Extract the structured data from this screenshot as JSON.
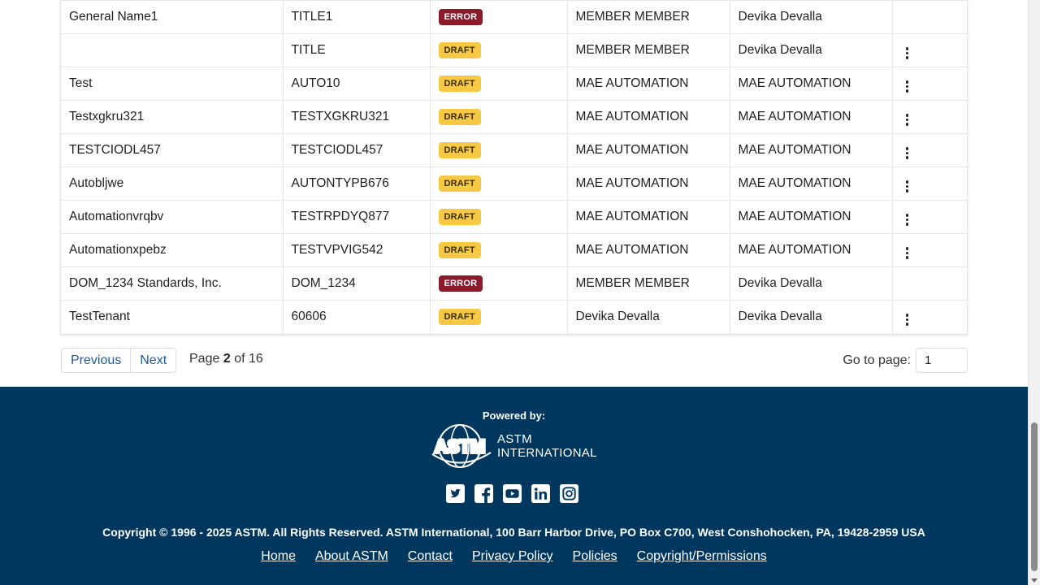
{
  "table": {
    "rows": [
      {
        "name": "General Name1",
        "code": "TITLE1",
        "status": "ERROR",
        "status_kind": "error",
        "created_by": "MEMBER MEMBER",
        "updated_by": "Devika Devalla",
        "has_menu": false
      },
      {
        "name": "",
        "code": "TITLE",
        "status": "DRAFT",
        "status_kind": "draft",
        "created_by": "MEMBER MEMBER",
        "updated_by": "Devika Devalla",
        "has_menu": true
      },
      {
        "name": "Test",
        "code": "AUTO10",
        "status": "DRAFT",
        "status_kind": "draft",
        "created_by": "MAE AUTOMATION",
        "updated_by": "MAE AUTOMATION",
        "has_menu": true
      },
      {
        "name": "Testxgkru321",
        "code": "TESTXGKRU321",
        "status": "DRAFT",
        "status_kind": "draft",
        "created_by": "MAE AUTOMATION",
        "updated_by": "MAE AUTOMATION",
        "has_menu": true
      },
      {
        "name": "TESTCIODL457",
        "code": "TESTCIODL457",
        "status": "DRAFT",
        "status_kind": "draft",
        "created_by": "MAE AUTOMATION",
        "updated_by": "MAE AUTOMATION",
        "has_menu": true
      },
      {
        "name": "Autobljwe",
        "code": "AUTONTYPB676",
        "status": "DRAFT",
        "status_kind": "draft",
        "created_by": "MAE AUTOMATION",
        "updated_by": "MAE AUTOMATION",
        "has_menu": true
      },
      {
        "name": "Automationvrqbv",
        "code": "TESTRPDYQ877",
        "status": "DRAFT",
        "status_kind": "draft",
        "created_by": "MAE AUTOMATION",
        "updated_by": "MAE AUTOMATION",
        "has_menu": true
      },
      {
        "name": "Automationxpebz",
        "code": "TESTVPVIG542",
        "status": "DRAFT",
        "status_kind": "draft",
        "created_by": "MAE AUTOMATION",
        "updated_by": "MAE AUTOMATION",
        "has_menu": true
      },
      {
        "name": "DOM_1234 Standards, Inc.",
        "code": "DOM_1234",
        "status": "ERROR",
        "status_kind": "error",
        "created_by": "MEMBER MEMBER",
        "updated_by": "Devika Devalla",
        "has_menu": false
      },
      {
        "name": "TestTenant",
        "code": "60606",
        "status": "DRAFT",
        "status_kind": "draft",
        "created_by": "Devika Devalla",
        "updated_by": "Devika Devalla",
        "has_menu": true
      }
    ],
    "row_menu_icon": "kebab-menu-icon"
  },
  "pagination": {
    "previous_label": "Previous",
    "next_label": "Next",
    "page_prefix": "Page",
    "current_page": "2",
    "page_of": "of 16",
    "goto_label": "Go to page:",
    "goto_value": "1"
  },
  "footer": {
    "powered_by": "Powered by:",
    "logo_text": "ASTM",
    "logo_line1": "ASTM",
    "logo_line2": "INTERNATIONAL",
    "social_icons": [
      "twitter-icon",
      "facebook-icon",
      "youtube-icon",
      "linkedin-icon",
      "instagram-icon"
    ],
    "copyright": "Copyright © 1996 - 2025 ASTM. All Rights Reserved. ASTM International, 100 Barr Harbor Drive, PO Box C700, West Conshohocken, PA, 19428-2959 USA",
    "links": [
      "Home",
      "About ASTM",
      "Contact",
      "Privacy Policy",
      "Policies",
      "Copyright/Permissions"
    ],
    "background_color": "#00375e"
  },
  "colors": {
    "error_badge": "#8b1a2b",
    "draft_badge": "#f7c843",
    "link_blue": "#1b5c9e"
  }
}
